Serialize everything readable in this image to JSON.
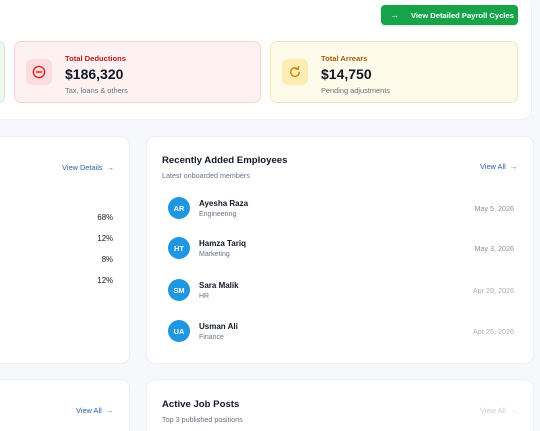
{
  "header": {
    "payroll_button": "View Detailed Payroll Cycles"
  },
  "stats": [
    {
      "label": "Total Deductions",
      "value": "$186,320",
      "sub": "Tax, loans & others",
      "icon": "minus-circle-icon",
      "color": "#b91c1c"
    },
    {
      "label": "Total Arrears",
      "value": "$14,750",
      "sub": "Pending adjustments",
      "icon": "refresh-icon",
      "color": "#a16207"
    }
  ],
  "left_panel": {
    "link": "View Details",
    "percentages": [
      "68%",
      "12%",
      "8%",
      "12%"
    ]
  },
  "recent_employees": {
    "title": "Recently Added Employees",
    "subtitle": "Latest onboarded members",
    "link": "View All",
    "items": [
      {
        "initials": "AR",
        "name": "Ayesha Raza",
        "dept": "Engineering",
        "date": "May 5, 2026"
      },
      {
        "initials": "HT",
        "name": "Hamza Tariq",
        "dept": "Marketing",
        "date": "May 3, 2026"
      },
      {
        "initials": "SM",
        "name": "Sara Malik",
        "dept": "HR",
        "date": "Apr 29, 2026"
      },
      {
        "initials": "UA",
        "name": "Usman Ali",
        "dept": "Finance",
        "date": "Apr 25, 2026"
      }
    ]
  },
  "bottom_left": {
    "link": "View All"
  },
  "job_posts": {
    "title": "Active Job Posts",
    "subtitle": "Top 3 published positions",
    "link": "View All"
  },
  "colors": {
    "primary_green": "#16a34a",
    "link_blue": "#2f5fb3",
    "avatar_blue": "#2196e0"
  }
}
